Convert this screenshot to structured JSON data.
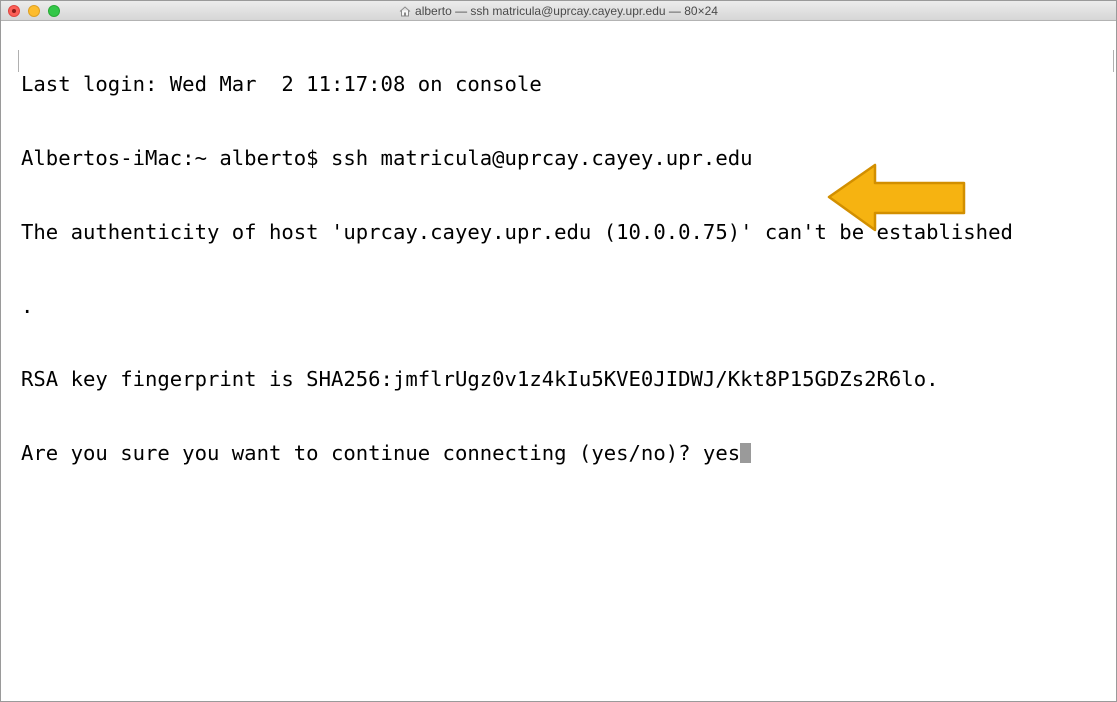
{
  "window": {
    "title": "alberto — ssh matricula@uprcay.cayey.upr.edu — 80×24",
    "title_icon": "home-icon"
  },
  "terminal": {
    "lines": [
      "Last login: Wed Mar  2 11:17:08 on console",
      "Albertos-iMac:~ alberto$ ssh matricula@uprcay.cayey.upr.edu",
      "The authenticity of host 'uprcay.cayey.upr.edu (10.0.0.75)' can't be established",
      ".",
      "RSA key fingerprint is SHA256:jmflrUgz0v1z4kIu5KVE0JIDWJ/Kkt8P15GDZs2R6lo.",
      "Are you sure you want to continue connecting (yes/no)? yes"
    ]
  },
  "colors": {
    "background": "#ffffff",
    "text": "#000000",
    "cursor": "#9a9a9a",
    "arrow_fill": "#f6b311",
    "arrow_stroke": "#d28f00"
  },
  "annotation": {
    "arrow_icon": "left-arrow-icon"
  }
}
